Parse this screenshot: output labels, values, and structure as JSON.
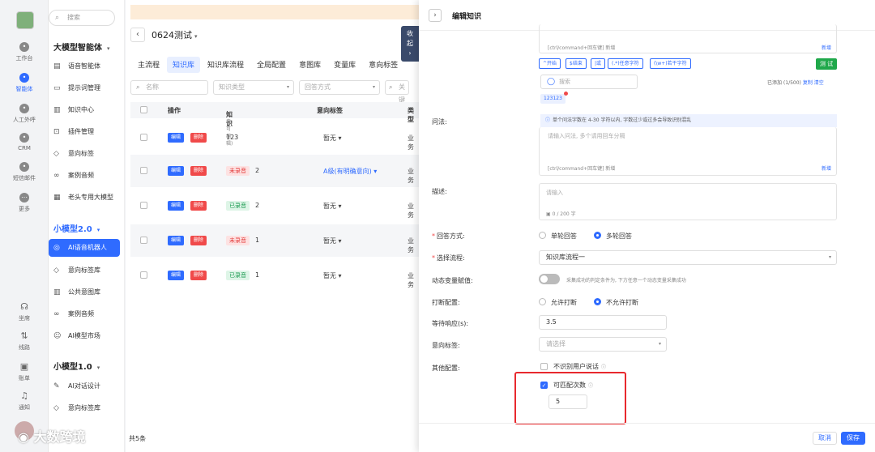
{
  "rail": {
    "items": [
      "工作台",
      "智能体",
      "人工外呼",
      "CRM",
      "短信邮件",
      "更多"
    ],
    "bottom": [
      "坐席",
      "线路",
      "账单",
      "通知"
    ]
  },
  "sidebar": {
    "search_placeholder": "搜索",
    "group1": "大模型智能体",
    "group1_items": [
      "语音智能体",
      "提示词管理",
      "知识中心",
      "插件管理",
      "意向标签",
      "案例音频",
      "老头专用大模型"
    ],
    "group2": "小模型2.0",
    "group2_items": [
      "AI语音机器人",
      "意向标签库",
      "公共意图库",
      "案例音频",
      "AI模型市场"
    ],
    "group3": "小模型1.0",
    "group3_items": [
      "AI对话设计",
      "意向标签库"
    ]
  },
  "main": {
    "project": "0624测试",
    "collapse": "收起",
    "tabs": [
      "主流程",
      "知识库",
      "知识库流程",
      "全局配置",
      "意图库",
      "变量库",
      "意向标签"
    ],
    "filters": [
      "名称",
      "知识类型",
      "回答方式",
      "关键"
    ],
    "columns": {
      "op": "操作",
      "knowledge": "知识",
      "knowledge_sub": "(双击可编辑)",
      "intent": "意向标签",
      "type": "类型"
    },
    "edit": "编辑",
    "del": "删除",
    "rows": [
      {
        "tag": "",
        "text": "123",
        "intent": "暂无",
        "type": "业务"
      },
      {
        "tag": "未录音",
        "text": "2",
        "intent": "A级(有明确意向)",
        "type": "业务"
      },
      {
        "tag": "已录音",
        "text": "2",
        "intent": "暂无",
        "type": "业务"
      },
      {
        "tag": "未录音",
        "text": "1",
        "intent": "暂无",
        "type": "业务"
      },
      {
        "tag": "已录音",
        "text": "1",
        "intent": "暂无",
        "type": "业务"
      }
    ],
    "total": "共5条"
  },
  "panel": {
    "title": "编辑知识",
    "shortcut_hint": "[ctrl/command+回车键] 新增",
    "add_link": "新增",
    "regex_buttons": [
      "^开始",
      "$结束",
      "|或",
      "(.*)任意字符",
      "(\\w+)若干字符"
    ],
    "test": "测 试",
    "kw_search": "搜索",
    "added": "已添加 (1/500)",
    "copy": "复制",
    "clear": "清空",
    "chip": "123123",
    "ask_label": "问法:",
    "ask_note": "单个问法字数在 4-30 字符以内, 字数过少或过多会导致识别混乱",
    "ask_placeholder": "请输入问法, 多个请用回车分隔",
    "desc_label": "描述:",
    "desc_placeholder": "请输入",
    "desc_count": "0 / 200 字",
    "answer_label": "回答方式:",
    "answer_opts": [
      "单轮回答",
      "多轮回答"
    ],
    "flow_label": "选择流程:",
    "flow_value": "知识库流程一",
    "var_label": "动态变量赋值:",
    "var_hint": "采集成功的判定条件为, 下方任意一个动态变量采集成功",
    "interrupt_label": "打断配置:",
    "interrupt_opts": [
      "允许打断",
      "不允许打断"
    ],
    "wait_label": "等待响应(s):",
    "wait_value": "3.5",
    "intent_label": "意向标签:",
    "intent_placeholder": "请选择",
    "other_label": "其他配置:",
    "ignore_user": "不识别用户说话",
    "match_label": "可匹配次数",
    "match_value": "5",
    "cancel": "取消",
    "save": "保存"
  },
  "watermark": "大数跨境"
}
